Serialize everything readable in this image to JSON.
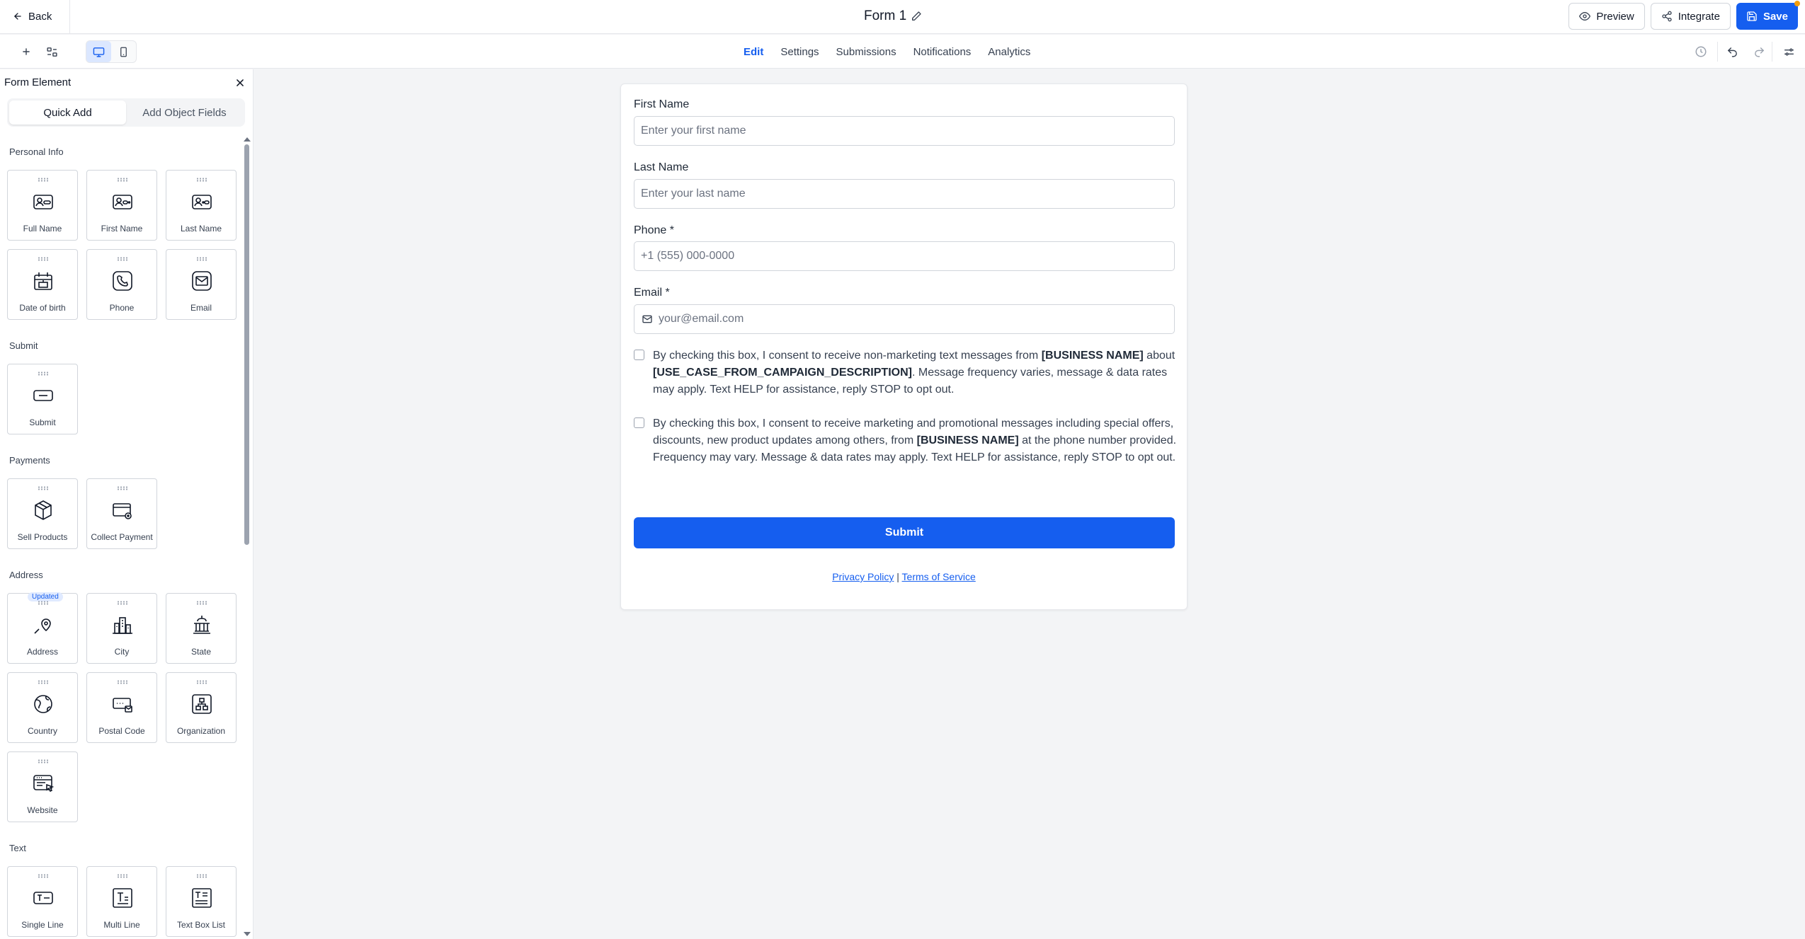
{
  "topbar": {
    "back_label": "Back",
    "form_title": "Form 1",
    "preview_label": "Preview",
    "integrate_label": "Integrate",
    "save_label": "Save"
  },
  "tabs": [
    "Edit",
    "Settings",
    "Submissions",
    "Notifications",
    "Analytics"
  ],
  "active_tab": "Edit",
  "sidebar": {
    "title": "Form Element",
    "segments": [
      "Quick Add",
      "Add Object Fields"
    ],
    "categories": {
      "personal": "Personal Info",
      "submit": "Submit",
      "payments": "Payments",
      "address": "Address",
      "text": "Text"
    },
    "tiles": {
      "full_name": "Full Name",
      "first_name": "First Name",
      "last_name": "Last Name",
      "dob": "Date of birth",
      "phone": "Phone",
      "email": "Email",
      "submit": "Submit",
      "sell_products": "Sell Products",
      "collect_payment": "Collect Payment",
      "address": "Address",
      "city": "City",
      "state": "State",
      "country": "Country",
      "postal_code": "Postal Code",
      "organization": "Organization",
      "website": "Website",
      "single_line": "Single Line",
      "multi_line": "Multi Line",
      "text_box_list": "Text Box List"
    },
    "updated_badge": "Updated"
  },
  "form": {
    "first_name_label": "First Name",
    "first_name_placeholder": "Enter your first name",
    "last_name_label": "Last Name",
    "last_name_placeholder": "Enter your last name",
    "phone_label": "Phone *",
    "phone_placeholder": "+1 (555) 000-0000",
    "email_label": "Email *",
    "email_placeholder": "your@email.com",
    "consent1": {
      "part1": "By checking this box, I consent to receive non-marketing text messages from ",
      "business": "[BUSINESS NAME]",
      "part2": " about ",
      "use_case": "[USE_CASE_FROM_CAMPAIGN_DESCRIPTION]",
      "part3": ". Message frequency varies, message & data rates may apply. Text HELP for assistance, reply STOP to opt out."
    },
    "consent2": {
      "part1": "By checking this box, I consent to receive marketing and promotional messages including special offers, discounts, new product updates among others, from ",
      "business": "[BUSINESS NAME]",
      "part2": " at the phone number provided. Frequency may vary. Message & data rates may apply. Text HELP for assistance, reply STOP to opt out."
    },
    "submit_label": "Submit",
    "privacy_label": "Privacy Policy",
    "separator": "|",
    "terms_label": "Terms of Service"
  },
  "colors": {
    "accent": "#155eef",
    "badge_dot": "#f59e0b"
  }
}
